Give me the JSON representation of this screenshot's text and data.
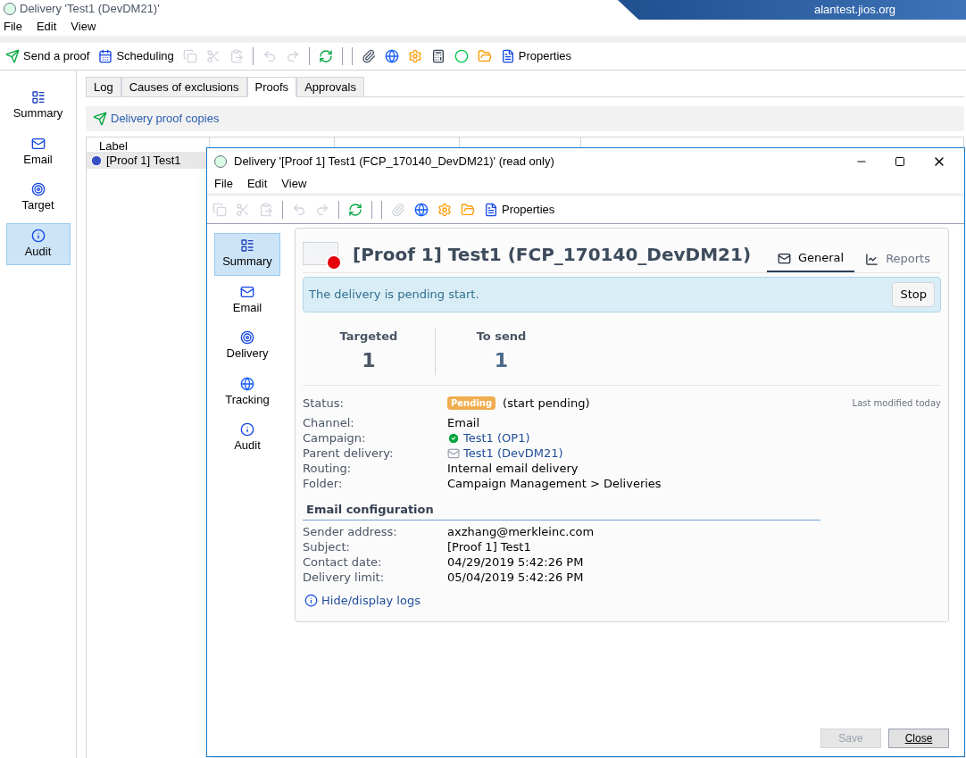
{
  "window": {
    "title": "Delivery 'Test1 (DevDM21)'",
    "server": "alantest.jios.org"
  },
  "menu": [
    "File",
    "Edit",
    "View"
  ],
  "toolbar": [
    {
      "kind": "proof",
      "label": "Send a proof",
      "disabled": false
    },
    {
      "kind": "calendar",
      "label": "Scheduling",
      "disabled": false
    },
    {
      "kind": "copy",
      "disabled": true
    },
    {
      "kind": "cut",
      "disabled": true
    },
    {
      "kind": "paste",
      "disabled": true
    },
    {
      "kind": "separator"
    },
    {
      "kind": "undo",
      "disabled": true
    },
    {
      "kind": "redo",
      "disabled": true
    },
    {
      "kind": "separator"
    },
    {
      "kind": "refresh",
      "disabled": false
    },
    {
      "kind": "separator"
    },
    {
      "kind": "separator"
    },
    {
      "kind": "attach",
      "disabled": false
    },
    {
      "kind": "globe",
      "disabled": false
    },
    {
      "kind": "gear",
      "disabled": false
    },
    {
      "kind": "calc",
      "disabled": false
    },
    {
      "kind": "circle",
      "disabled": false
    },
    {
      "kind": "folder",
      "disabled": false
    },
    {
      "kind": "props",
      "label": "Properties",
      "disabled": false
    }
  ],
  "sidebar": [
    {
      "label": "Summary",
      "kind": "summary",
      "selected": false
    },
    {
      "label": "Email",
      "kind": "email",
      "selected": false
    },
    {
      "label": "Target",
      "kind": "target",
      "selected": false
    },
    {
      "label": "Audit",
      "kind": "audit",
      "selected": true
    }
  ],
  "tabs": [
    {
      "label": "Log",
      "selected": false
    },
    {
      "label": "Causes of exclusions",
      "selected": false
    },
    {
      "label": "Proofs",
      "selected": true
    },
    {
      "label": "Approvals",
      "selected": false
    }
  ],
  "proofs": {
    "heading": "Delivery proof copies",
    "columns": [
      "Label"
    ],
    "rows": [
      {
        "label": "[Proof 1] Test1",
        "selected": true
      }
    ]
  },
  "dialog": {
    "title": "Delivery '[Proof 1] Test1 (FCP_170140_DevDM21)' (read only)",
    "menu": [
      "File",
      "Edit",
      "View"
    ],
    "toolbar": [
      {
        "kind": "copy",
        "disabled": true
      },
      {
        "kind": "cut",
        "disabled": true
      },
      {
        "kind": "paste",
        "disabled": true
      },
      {
        "kind": "separator"
      },
      {
        "kind": "undo",
        "disabled": true
      },
      {
        "kind": "redo",
        "disabled": true
      },
      {
        "kind": "separator"
      },
      {
        "kind": "refresh",
        "disabled": false
      },
      {
        "kind": "separator"
      },
      {
        "kind": "separator"
      },
      {
        "kind": "attach",
        "disabled": true
      },
      {
        "kind": "globe",
        "disabled": false
      },
      {
        "kind": "gear",
        "disabled": false
      },
      {
        "kind": "folder",
        "disabled": false
      },
      {
        "kind": "props",
        "label": "Properties",
        "disabled": false
      }
    ],
    "sidebar": [
      {
        "label": "Summary",
        "kind": "summary",
        "selected": true
      },
      {
        "label": "Email",
        "kind": "email",
        "selected": false
      },
      {
        "label": "Delivery",
        "kind": "target",
        "selected": false
      },
      {
        "label": "Tracking",
        "kind": "globe",
        "selected": false
      },
      {
        "label": "Audit",
        "kind": "audit",
        "selected": false
      }
    ],
    "heading": "[Proof 1] Test1 (FCP_170140_DevDM21)",
    "views": [
      {
        "label": "General",
        "kind": "mail",
        "selected": true
      },
      {
        "label": "Reports",
        "kind": "chart",
        "selected": false
      }
    ],
    "alert": "The delivery is pending start.",
    "stop_button": "Stop",
    "stats": [
      {
        "label": "Targeted",
        "value": "1"
      },
      {
        "label": "To send",
        "value": "1"
      }
    ],
    "status": {
      "label": "Status:",
      "badge": "Pending",
      "text": "(start pending)",
      "modified": "Last modified today"
    },
    "details": [
      {
        "label": "Channel:",
        "value": "Email",
        "kind": "text"
      },
      {
        "label": "Campaign:",
        "value": "Test1 (OP1)",
        "kind": "campaign"
      },
      {
        "label": "Parent delivery:",
        "value": "Test1 (DevDM21)",
        "kind": "delivery"
      },
      {
        "label": "Routing:",
        "value": "Internal email delivery",
        "kind": "text"
      },
      {
        "label": "Folder:",
        "value": "Campaign Management > Deliveries",
        "kind": "text"
      }
    ],
    "config_heading": "Email configuration",
    "config": [
      {
        "label": "Sender address:",
        "value": "axzhang@merkleinc.com"
      },
      {
        "label": "Subject:",
        "value": "[Proof 1] Test1"
      },
      {
        "label": "Contact date:",
        "value": "04/29/2019 5:42:26 PM"
      },
      {
        "label": "Delivery limit:",
        "value": "05/04/2019 5:42:26 PM"
      }
    ],
    "logs_link": "Hide/display logs",
    "buttons": [
      {
        "label": "Save",
        "disabled": true
      },
      {
        "label": "Close",
        "disabled": false
      }
    ]
  }
}
